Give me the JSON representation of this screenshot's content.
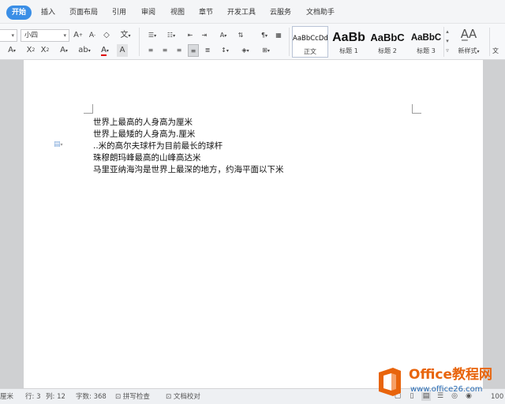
{
  "menu": {
    "tabs": [
      "开始",
      "插入",
      "页面布局",
      "引用",
      "审阅",
      "视图",
      "章节",
      "开发工具",
      "云服务",
      "文档助手"
    ],
    "active_tab": "开始"
  },
  "ribbon": {
    "font_size_value": "小四",
    "styles": [
      {
        "sample": "AaBbCcDd",
        "label": "正文"
      },
      {
        "sample": "AaBb",
        "label": "标题 1"
      },
      {
        "sample": "AaBbC",
        "label": "标题 2"
      },
      {
        "sample": "AaBbC",
        "label": "标题 3"
      }
    ],
    "new_style_label": "新样式",
    "cut_right_label": "文"
  },
  "document": {
    "lines": [
      "世界上最高的人身高为厘米",
      "世界上最矮的人身高为.厘米",
      "..米的高尔夫球杆为目前最长的球杆",
      "珠穆朗玛峰最高的山峰高达米",
      "马里亚纳海沟是世界上最深的地方，约海平面以下米"
    ]
  },
  "status": {
    "unit_partial": "厘米",
    "row": "行: 3",
    "col": "列: 12",
    "word_count": "字数: 368",
    "spell_check": "拼写检查",
    "doc_proof": "文档校对",
    "zoom_partial": "100"
  },
  "watermark": {
    "title": "Office教程网",
    "url": "www.office26.com"
  },
  "colors": {
    "accent": "#3a8ee6",
    "watermark_orange": "#e8640c",
    "watermark_blue": "#2a6db5"
  }
}
